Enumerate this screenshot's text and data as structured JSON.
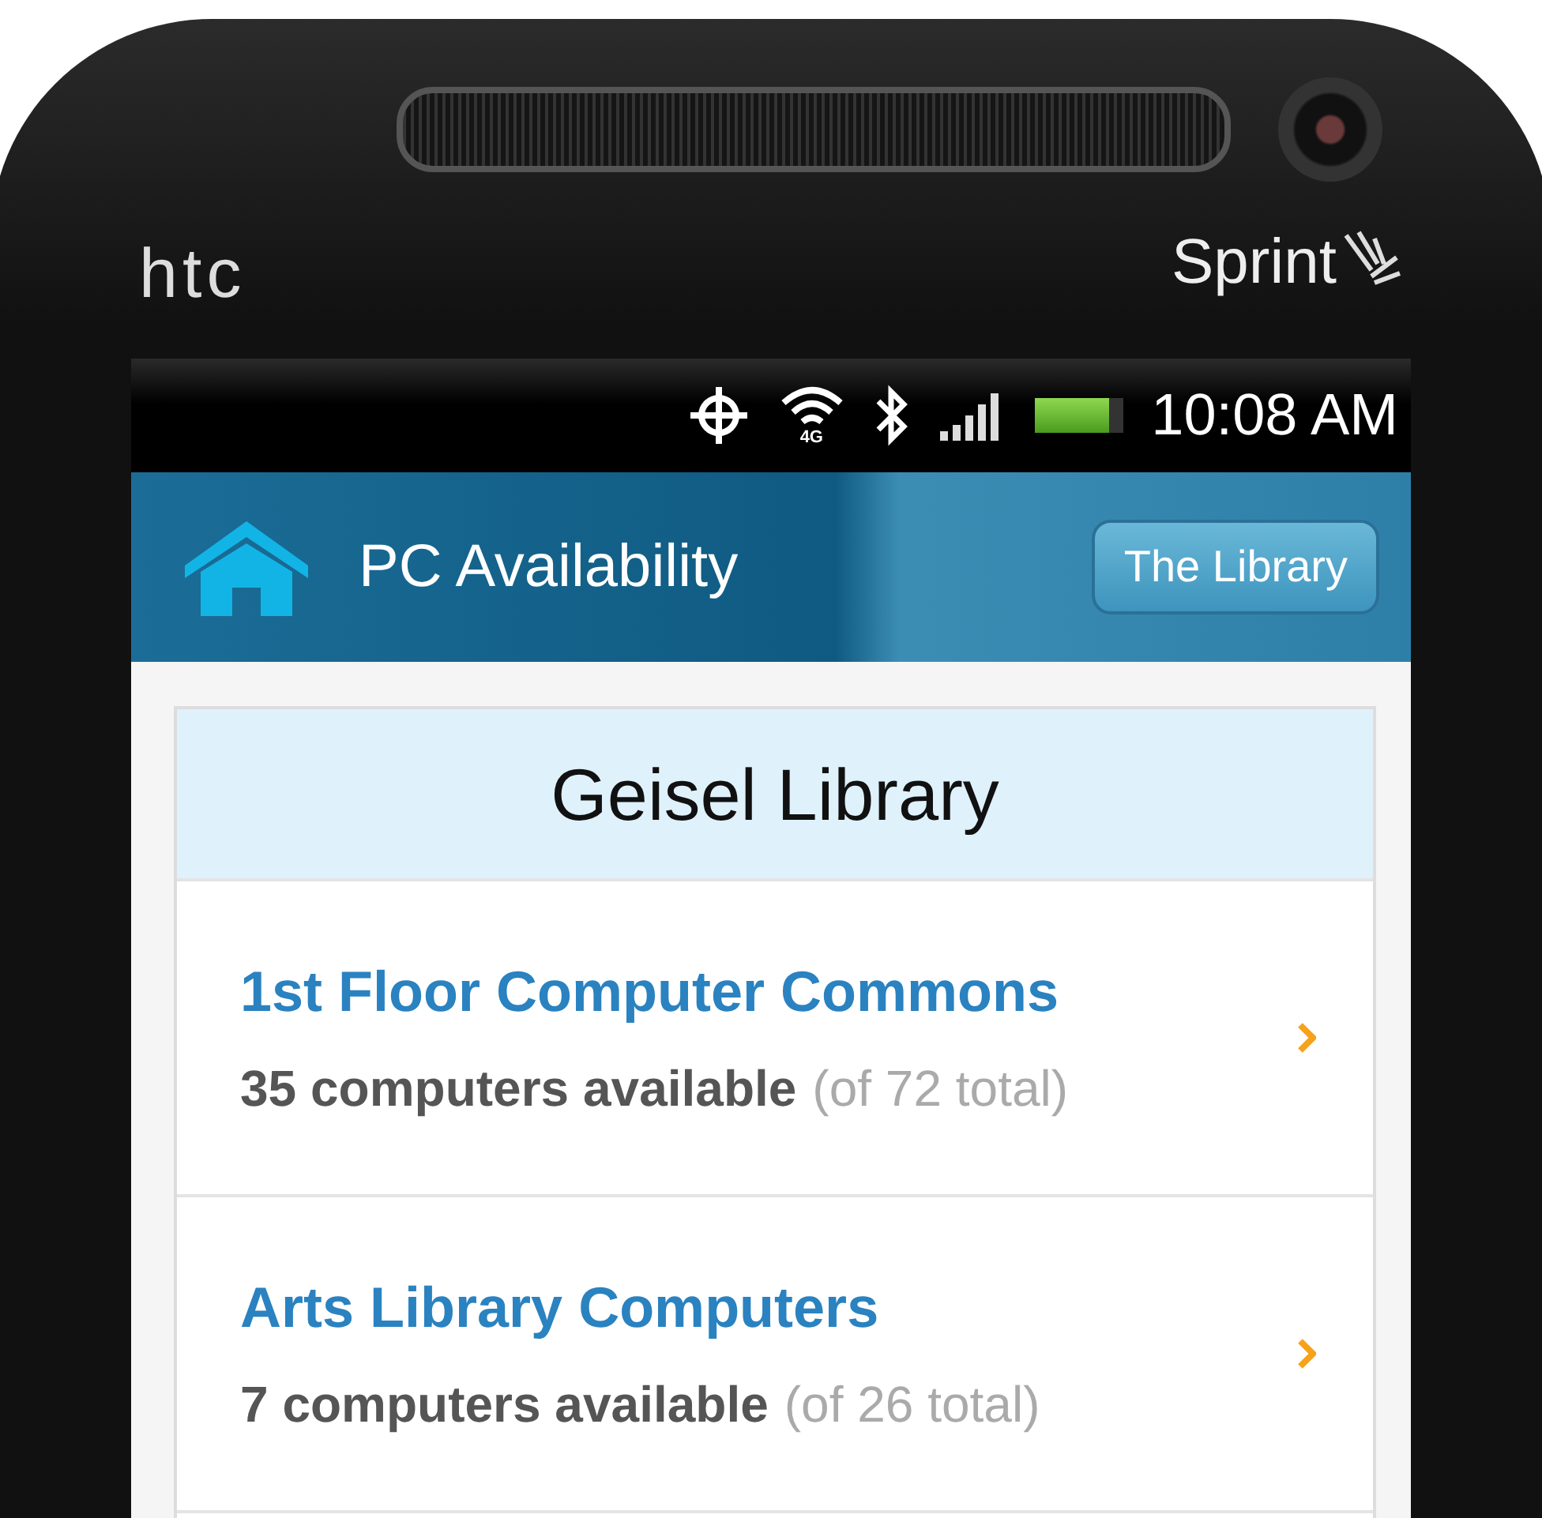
{
  "device": {
    "maker_label": "htc",
    "carrier_label": "Sprint"
  },
  "status_bar": {
    "network_label": "4G",
    "time": "10:08 AM"
  },
  "app_bar": {
    "title": "PC Availability",
    "button": "The Library"
  },
  "section": {
    "title": "Geisel Library"
  },
  "locations": [
    {
      "name": "1st Floor Computer Commons",
      "available": "35 computers available",
      "total": "(of 72 total)"
    },
    {
      "name": "Arts Library Computers",
      "available": "7 computers available",
      "total": "(of 26 total)"
    }
  ]
}
